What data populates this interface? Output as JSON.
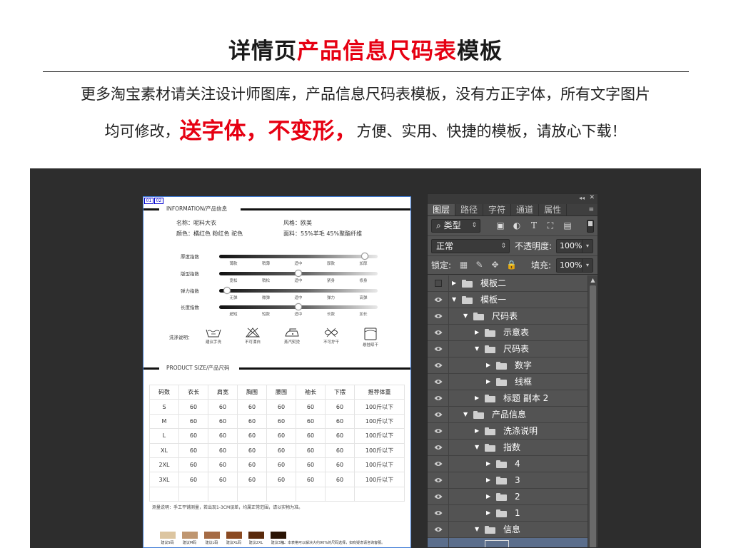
{
  "hero": {
    "title_left": "详情页",
    "title_red": "产品信息尺码表",
    "title_right": "模板",
    "line1": "更多淘宝素材请关注设计师图库，产品信息尺码表模板，没有方正字体，所有文字图片",
    "line2_prefix": "均可修改，",
    "line2_red": "送字体，不变形，",
    "line2_suffix": "方便、实用、快捷的模板，请放心下载！"
  },
  "doc": {
    "corner_tags": [
      "01",
      "02"
    ],
    "info_header": "INFORMATION/产品信息",
    "name": "名称：呢料大衣",
    "style": "风格：欧美",
    "color": "颜色：橘红色 粉红色 驼色",
    "fabric": "面料：55%羊毛  45%聚酯纤维",
    "sliders": [
      {
        "label": "厚度指数",
        "ticks": [
          "薄款",
          "稍薄",
          "适中",
          "厚款",
          "加厚"
        ],
        "value": 0.92
      },
      {
        "label": "版型指数",
        "ticks": [
          "宽松",
          "稍松",
          "适中",
          "紧身",
          "修身"
        ],
        "value": 0.5
      },
      {
        "label": "弹力指数",
        "ticks": [
          "无弹",
          "微弹",
          "适中",
          "弹力",
          "高弹"
        ],
        "value": 0.05
      },
      {
        "label": "长度指数",
        "ticks": [
          "超短",
          "短款",
          "适中",
          "长款",
          "加长"
        ],
        "value": 0.5
      }
    ],
    "wash_label": "洗涤说明：",
    "wash_items": [
      {
        "icon": "hand-wash-icon",
        "label": "建议手洗"
      },
      {
        "icon": "no-bleach-icon",
        "label": "不可漂白"
      },
      {
        "icon": "steam-iron-icon",
        "label": "蒸汽熨烫"
      },
      {
        "icon": "no-wring-icon",
        "label": "不可拧干"
      },
      {
        "icon": "hang-dry-icon",
        "label": "悬挂晾干"
      }
    ],
    "size_header": "PRODUCT SIZE/产品尺码",
    "table": {
      "headers": [
        "码数",
        "衣长",
        "肩宽",
        "胸围",
        "腰围",
        "袖长",
        "下摆",
        "推荐体重"
      ],
      "rows": [
        [
          "S",
          "60",
          "60",
          "60",
          "60",
          "60",
          "60",
          "100斤以下"
        ],
        [
          "M",
          "60",
          "60",
          "60",
          "60",
          "60",
          "60",
          "100斤以下"
        ],
        [
          "L",
          "60",
          "60",
          "60",
          "60",
          "60",
          "60",
          "100斤以下"
        ],
        [
          "XL",
          "60",
          "60",
          "60",
          "60",
          "60",
          "60",
          "100斤以下"
        ],
        [
          "2XL",
          "60",
          "60",
          "60",
          "60",
          "60",
          "60",
          "100斤以下"
        ],
        [
          "3XL",
          "60",
          "60",
          "60",
          "60",
          "60",
          "60",
          "100斤以下"
        ],
        [
          "",
          "",
          "",
          "",
          "",
          "",
          "",
          ""
        ]
      ]
    },
    "measure_note": "测量说明：手工平铺测量，若出现1-3CM误差，均属正常范围，请以实物为准。",
    "swatches": [
      {
        "color": "#dcc5a0",
        "label": "建议S码"
      },
      {
        "color": "#bf9670",
        "label": "建议M码"
      },
      {
        "color": "#a56b44",
        "label": "建议L码"
      },
      {
        "color": "#8b4a22",
        "label": "建议XL码"
      },
      {
        "color": "#5a2a0c",
        "label": "建议2XL"
      },
      {
        "color": "#2a1405",
        "label": "建议3XL"
      }
    ],
    "swatch_note": "注：本表格可以解决大约90%的尺码选择，如有疑虑请咨询客服。"
  },
  "panel": {
    "collapse": "◂◂",
    "close": "✕",
    "tabs": [
      "图层",
      "路径",
      "字符",
      "通道",
      "属性"
    ],
    "active_tab": "图层",
    "menu_icon": "≡",
    "filter_kind": "类型",
    "blend_mode": "正常",
    "opacity_label": "不透明度:",
    "opacity_value": "100%",
    "lock_label": "锁定:",
    "fill_label": "填充:",
    "fill_value": "100%",
    "layers": [
      {
        "name": "模板二",
        "depth": 0,
        "expanded": false,
        "visible": false
      },
      {
        "name": "模板一",
        "depth": 0,
        "expanded": true,
        "visible": true
      },
      {
        "name": "尺码表",
        "depth": 1,
        "expanded": true,
        "visible": true
      },
      {
        "name": "示意表",
        "depth": 2,
        "expanded": false,
        "visible": true
      },
      {
        "name": "尺码表",
        "depth": 2,
        "expanded": true,
        "visible": true
      },
      {
        "name": "数字",
        "depth": 3,
        "expanded": false,
        "visible": true
      },
      {
        "name": "线框",
        "depth": 3,
        "expanded": false,
        "visible": true
      },
      {
        "name": "标题 副本 2",
        "depth": 2,
        "expanded": false,
        "visible": true
      },
      {
        "name": "产品信息",
        "depth": 1,
        "expanded": true,
        "visible": true
      },
      {
        "name": "洗涤说明",
        "depth": 2,
        "expanded": false,
        "visible": true
      },
      {
        "name": "指数",
        "depth": 2,
        "expanded": true,
        "visible": true
      },
      {
        "name": "4",
        "depth": 3,
        "expanded": false,
        "visible": true
      },
      {
        "name": "3",
        "depth": 3,
        "expanded": false,
        "visible": true
      },
      {
        "name": "2",
        "depth": 3,
        "expanded": false,
        "visible": true
      },
      {
        "name": "1",
        "depth": 3,
        "expanded": false,
        "visible": true
      },
      {
        "name": "信息",
        "depth": 2,
        "expanded": true,
        "visible": true
      },
      {
        "name": "",
        "depth": 3,
        "expanded": false,
        "visible": false,
        "selected": true
      }
    ]
  }
}
